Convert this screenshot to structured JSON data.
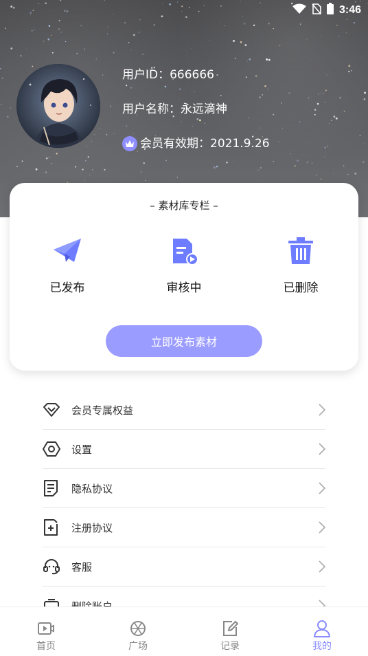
{
  "status_bar": {
    "time": "3:46"
  },
  "profile": {
    "user_id": "用户ID：666666",
    "user_name": "用户名称：永远滴神",
    "membership": "会员有效期：2021.9.26"
  },
  "library_card": {
    "title": "– 素材库专栏 –",
    "actions": [
      {
        "label": "已发布",
        "icon": "paper-plane-icon"
      },
      {
        "label": "审核中",
        "icon": "document-play-icon"
      },
      {
        "label": "已删除",
        "icon": "trash-icon"
      }
    ],
    "publish_button": "立即发布素材"
  },
  "menu": {
    "items": [
      {
        "label": "会员专属权益",
        "icon": "diamond-icon"
      },
      {
        "label": "设置",
        "icon": "settings-hexagon-icon"
      },
      {
        "label": "隐私协议",
        "icon": "document-icon"
      },
      {
        "label": "注册协议",
        "icon": "document-plus-icon"
      },
      {
        "label": "客服",
        "icon": "headset-icon"
      },
      {
        "label": "删除账户",
        "icon": "account-icon"
      }
    ]
  },
  "tabbar": {
    "tabs": [
      {
        "label": "首页",
        "icon": "video-icon"
      },
      {
        "label": "广场",
        "icon": "aperture-icon"
      },
      {
        "label": "记录",
        "icon": "edit-icon"
      },
      {
        "label": "我的",
        "icon": "user-icon",
        "active": true
      }
    ]
  },
  "colors": {
    "accent": "#8a8cff",
    "button": "#9b9cff",
    "icon_blue": "#6e7dff"
  }
}
